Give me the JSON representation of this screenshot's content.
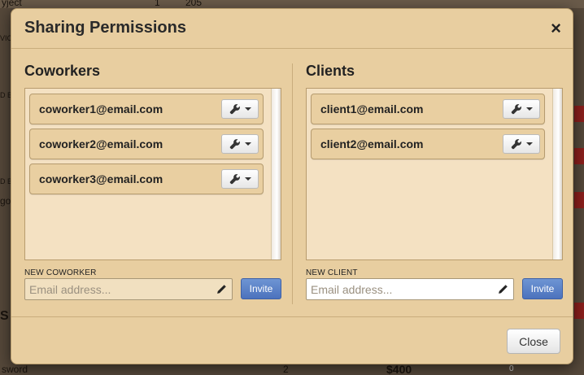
{
  "background": {
    "snippets": [
      "yject",
      "1",
      "205",
      "VIC",
      "D B",
      "D",
      "D B",
      "D B",
      "gol",
      "S",
      "D B",
      "sword",
      "2",
      "$400",
      "0"
    ]
  },
  "modal": {
    "title": "Sharing Permissions",
    "close_icon": "×",
    "coworkers": {
      "title": "Coworkers",
      "items": [
        {
          "email": "coworker1@email.com"
        },
        {
          "email": "coworker2@email.com"
        },
        {
          "email": "coworker3@email.com"
        }
      ],
      "new_label": "NEW COWORKER",
      "placeholder": "Email address...",
      "invite_label": "Invite"
    },
    "clients": {
      "title": "Clients",
      "items": [
        {
          "email": "client1@email.com"
        },
        {
          "email": "client2@email.com"
        }
      ],
      "new_label": "NEW CLIENT",
      "placeholder": "Email address...",
      "invite_label": "Invite"
    },
    "footer": {
      "close_label": "Close"
    }
  },
  "icons": {
    "item_action": "wrench-icon",
    "dropdown": "caret-down-icon",
    "edit": "pencil-icon"
  },
  "colors": {
    "modal_bg": "#e8cea0",
    "list_bg": "#f4e1c2",
    "invite_btn": "#5a80c8",
    "badge_red": "#8c1f1c"
  }
}
